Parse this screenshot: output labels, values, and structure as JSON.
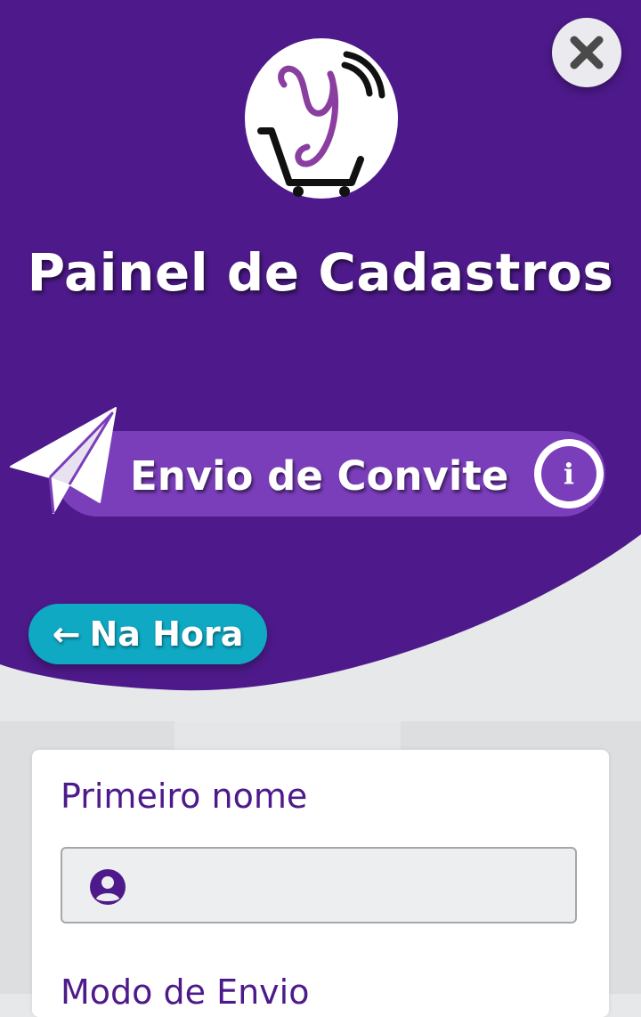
{
  "header": {
    "title": "Painel de Cadastros",
    "close_icon": "close-icon",
    "logo": "Y shopping-cart logo"
  },
  "invite_section": {
    "label": "Envio de Convite",
    "icon": "paper-plane-icon",
    "info_glyph": "i"
  },
  "mode_button": {
    "arrow": "←",
    "label": "Na Hora"
  },
  "form": {
    "first_name_label": "Primeiro nome",
    "first_name_value": "",
    "second_label": "Modo de Envio"
  },
  "colors": {
    "primary_purple": "#4e1a8b",
    "pill_purple": "#7a3eba",
    "cyan_button": "#0fa9c4",
    "background": "#e6e8e9"
  }
}
